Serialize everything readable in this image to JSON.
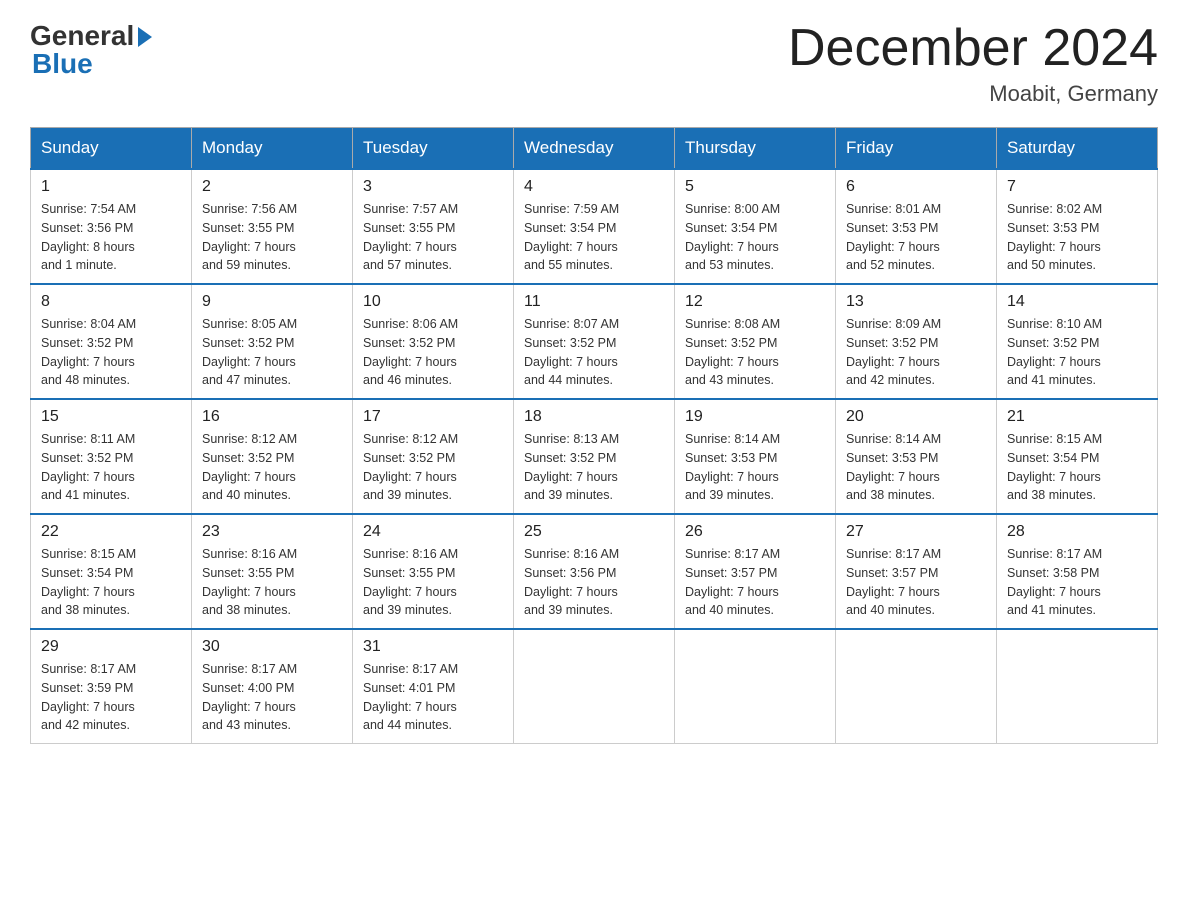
{
  "header": {
    "logo_general": "General",
    "logo_blue": "Blue",
    "title": "December 2024",
    "subtitle": "Moabit, Germany"
  },
  "days_of_week": [
    "Sunday",
    "Monday",
    "Tuesday",
    "Wednesday",
    "Thursday",
    "Friday",
    "Saturday"
  ],
  "weeks": [
    [
      {
        "day": "1",
        "sunrise": "7:54 AM",
        "sunset": "3:56 PM",
        "daylight": "8 hours and 1 minute."
      },
      {
        "day": "2",
        "sunrise": "7:56 AM",
        "sunset": "3:55 PM",
        "daylight": "7 hours and 59 minutes."
      },
      {
        "day": "3",
        "sunrise": "7:57 AM",
        "sunset": "3:55 PM",
        "daylight": "7 hours and 57 minutes."
      },
      {
        "day": "4",
        "sunrise": "7:59 AM",
        "sunset": "3:54 PM",
        "daylight": "7 hours and 55 minutes."
      },
      {
        "day": "5",
        "sunrise": "8:00 AM",
        "sunset": "3:54 PM",
        "daylight": "7 hours and 53 minutes."
      },
      {
        "day": "6",
        "sunrise": "8:01 AM",
        "sunset": "3:53 PM",
        "daylight": "7 hours and 52 minutes."
      },
      {
        "day": "7",
        "sunrise": "8:02 AM",
        "sunset": "3:53 PM",
        "daylight": "7 hours and 50 minutes."
      }
    ],
    [
      {
        "day": "8",
        "sunrise": "8:04 AM",
        "sunset": "3:52 PM",
        "daylight": "7 hours and 48 minutes."
      },
      {
        "day": "9",
        "sunrise": "8:05 AM",
        "sunset": "3:52 PM",
        "daylight": "7 hours and 47 minutes."
      },
      {
        "day": "10",
        "sunrise": "8:06 AM",
        "sunset": "3:52 PM",
        "daylight": "7 hours and 46 minutes."
      },
      {
        "day": "11",
        "sunrise": "8:07 AM",
        "sunset": "3:52 PM",
        "daylight": "7 hours and 44 minutes."
      },
      {
        "day": "12",
        "sunrise": "8:08 AM",
        "sunset": "3:52 PM",
        "daylight": "7 hours and 43 minutes."
      },
      {
        "day": "13",
        "sunrise": "8:09 AM",
        "sunset": "3:52 PM",
        "daylight": "7 hours and 42 minutes."
      },
      {
        "day": "14",
        "sunrise": "8:10 AM",
        "sunset": "3:52 PM",
        "daylight": "7 hours and 41 minutes."
      }
    ],
    [
      {
        "day": "15",
        "sunrise": "8:11 AM",
        "sunset": "3:52 PM",
        "daylight": "7 hours and 41 minutes."
      },
      {
        "day": "16",
        "sunrise": "8:12 AM",
        "sunset": "3:52 PM",
        "daylight": "7 hours and 40 minutes."
      },
      {
        "day": "17",
        "sunrise": "8:12 AM",
        "sunset": "3:52 PM",
        "daylight": "7 hours and 39 minutes."
      },
      {
        "day": "18",
        "sunrise": "8:13 AM",
        "sunset": "3:52 PM",
        "daylight": "7 hours and 39 minutes."
      },
      {
        "day": "19",
        "sunrise": "8:14 AM",
        "sunset": "3:53 PM",
        "daylight": "7 hours and 39 minutes."
      },
      {
        "day": "20",
        "sunrise": "8:14 AM",
        "sunset": "3:53 PM",
        "daylight": "7 hours and 38 minutes."
      },
      {
        "day": "21",
        "sunrise": "8:15 AM",
        "sunset": "3:54 PM",
        "daylight": "7 hours and 38 minutes."
      }
    ],
    [
      {
        "day": "22",
        "sunrise": "8:15 AM",
        "sunset": "3:54 PM",
        "daylight": "7 hours and 38 minutes."
      },
      {
        "day": "23",
        "sunrise": "8:16 AM",
        "sunset": "3:55 PM",
        "daylight": "7 hours and 38 minutes."
      },
      {
        "day": "24",
        "sunrise": "8:16 AM",
        "sunset": "3:55 PM",
        "daylight": "7 hours and 39 minutes."
      },
      {
        "day": "25",
        "sunrise": "8:16 AM",
        "sunset": "3:56 PM",
        "daylight": "7 hours and 39 minutes."
      },
      {
        "day": "26",
        "sunrise": "8:17 AM",
        "sunset": "3:57 PM",
        "daylight": "7 hours and 40 minutes."
      },
      {
        "day": "27",
        "sunrise": "8:17 AM",
        "sunset": "3:57 PM",
        "daylight": "7 hours and 40 minutes."
      },
      {
        "day": "28",
        "sunrise": "8:17 AM",
        "sunset": "3:58 PM",
        "daylight": "7 hours and 41 minutes."
      }
    ],
    [
      {
        "day": "29",
        "sunrise": "8:17 AM",
        "sunset": "3:59 PM",
        "daylight": "7 hours and 42 minutes."
      },
      {
        "day": "30",
        "sunrise": "8:17 AM",
        "sunset": "4:00 PM",
        "daylight": "7 hours and 43 minutes."
      },
      {
        "day": "31",
        "sunrise": "8:17 AM",
        "sunset": "4:01 PM",
        "daylight": "7 hours and 44 minutes."
      },
      null,
      null,
      null,
      null
    ]
  ],
  "labels": {
    "sunrise": "Sunrise:",
    "sunset": "Sunset:",
    "daylight": "Daylight:"
  }
}
